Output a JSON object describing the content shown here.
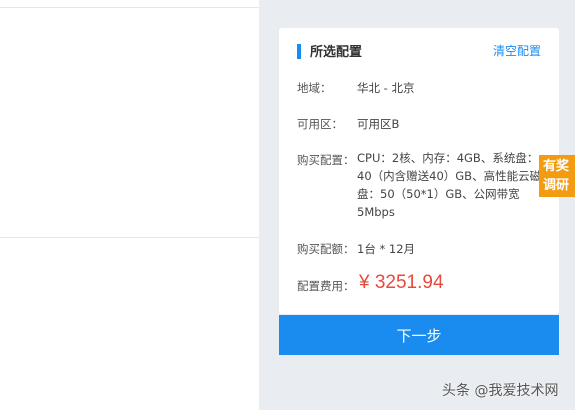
{
  "summary": {
    "title": "所选配置",
    "clear_link": "清空配置",
    "region_label": "地域：",
    "region_value": "华北 - 北京",
    "zone_label": "可用区：",
    "zone_value": "可用区B",
    "config_label": "购买配置：",
    "config_value": "CPU：2核、内存：4GB、系统盘：40（内含赠送40）GB、高性能云磁盘：50（50*1）GB、公网带宽5Mbps",
    "amount_label": "购买配额：",
    "amount_value": "1台 * 12月",
    "cost_label": "配置费用：",
    "cost_value": "¥ 3251.94"
  },
  "next_button": "下一步",
  "survey_tab": {
    "line1": "有奖",
    "line2": "调研"
  },
  "watermark": "头条 @我爱技术网",
  "colors": {
    "accent": "#1a8cf0",
    "price": "#e84a3c",
    "survey": "#f39c12",
    "side_background": "#e9edf1"
  }
}
